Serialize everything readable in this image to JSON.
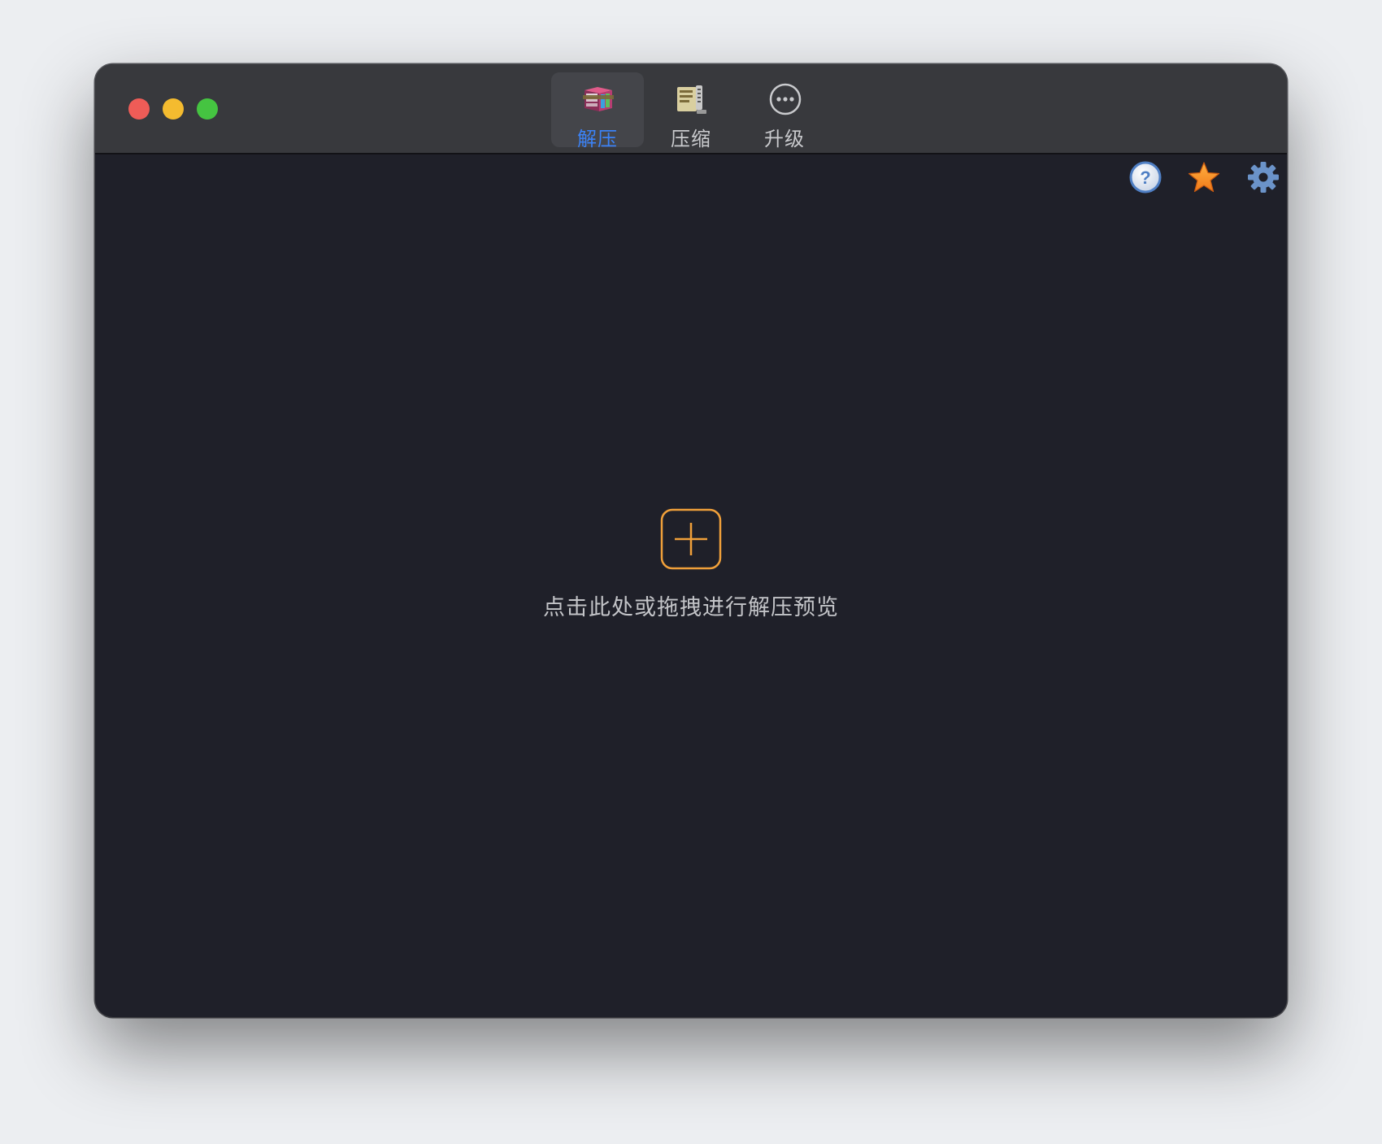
{
  "window": {
    "traffic_lights": [
      "close",
      "minimize",
      "zoom"
    ]
  },
  "toolbar": {
    "tabs": [
      {
        "label": "解压",
        "icon": "extract-books-icon",
        "active": true
      },
      {
        "label": "压缩",
        "icon": "compress-archive-icon",
        "active": false
      },
      {
        "label": "升级",
        "icon": "more-ellipsis-icon",
        "active": false
      }
    ],
    "active_color": "#3b82f6"
  },
  "actions": [
    {
      "icon": "help-icon"
    },
    {
      "icon": "star-icon"
    },
    {
      "icon": "gear-icon"
    }
  ],
  "main": {
    "add_icon": "plus-square-icon",
    "hint": "点击此处或拖拽进行解压预览",
    "accent_color": "#f0a03a"
  }
}
